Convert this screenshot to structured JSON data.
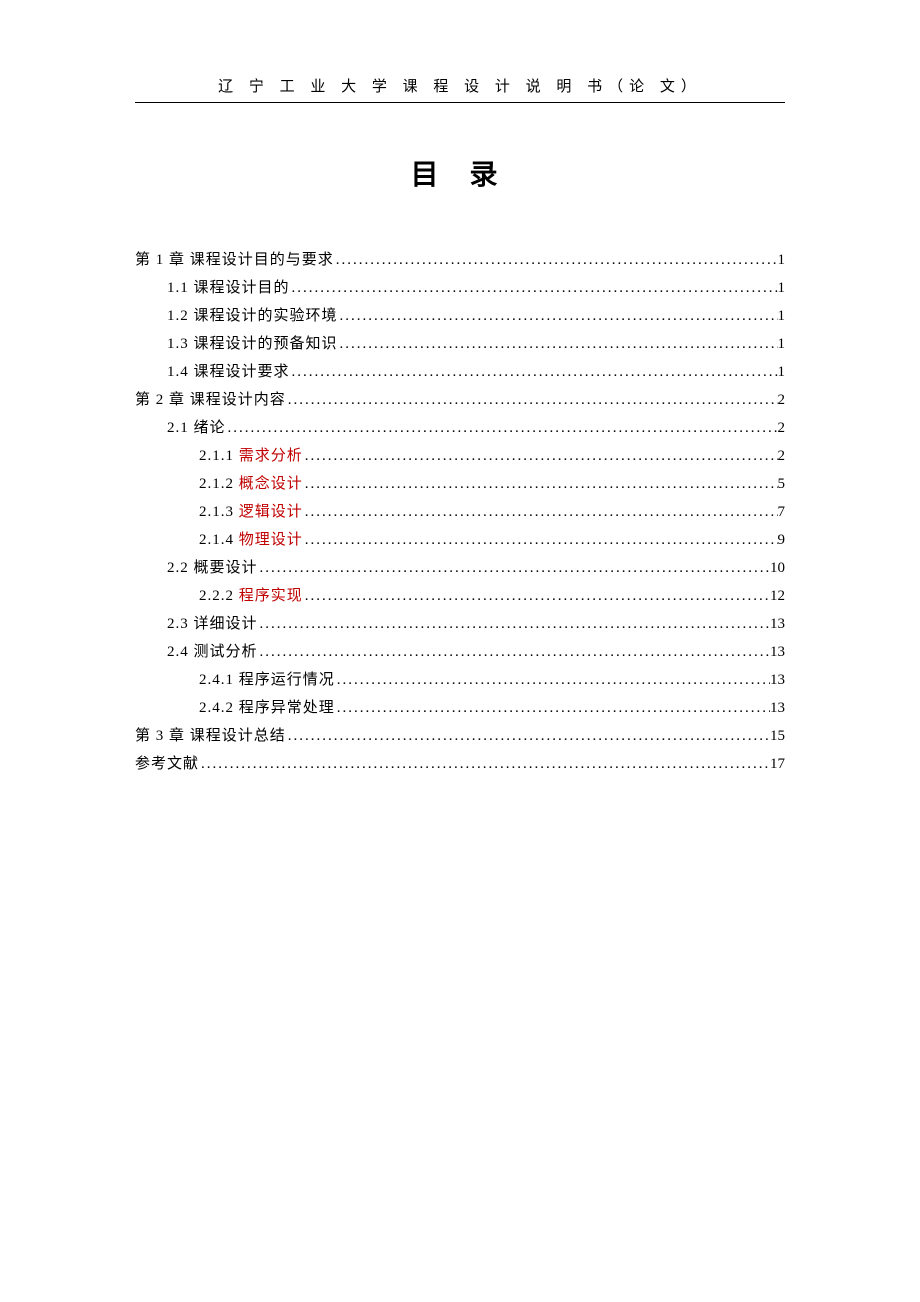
{
  "header": "辽 宁 工 业 大 学 课 程 设 计 说 明 书（论 文）",
  "title": "目  录",
  "toc": [
    {
      "level": 0,
      "label_pre": "第 1 章   课程设计目的与要求 ",
      "label_hl": "",
      "label_post": "",
      "page": "1"
    },
    {
      "level": 1,
      "label_pre": "1.1 课程设计目的",
      "label_hl": "",
      "label_post": "",
      "page": "1"
    },
    {
      "level": 1,
      "label_pre": "1.2 课程设计的实验环境",
      "label_hl": "",
      "label_post": "",
      "page": "1"
    },
    {
      "level": 1,
      "label_pre": "1.3 课程设计的预备知识",
      "label_hl": "",
      "label_post": "",
      "page": "1"
    },
    {
      "level": 1,
      "label_pre": "1.4 课程设计要求",
      "label_hl": "",
      "label_post": "",
      "page": "1"
    },
    {
      "level": 0,
      "label_pre": "第 2 章   课程设计内容 ",
      "label_hl": "",
      "label_post": "",
      "page": "2"
    },
    {
      "level": 1,
      "label_pre": "2.1 绪论",
      "label_hl": "",
      "label_post": "",
      "page": "2"
    },
    {
      "level": 2,
      "label_pre": "2.1.1 ",
      "label_hl": "需求分析",
      "label_post": "",
      "page": "2"
    },
    {
      "level": 2,
      "label_pre": "2.1.2 ",
      "label_hl": "概念设计",
      "label_post": "",
      "page": "5"
    },
    {
      "level": 2,
      "label_pre": "2.1.3 ",
      "label_hl": "逻辑设计",
      "label_post": "",
      "page": "7"
    },
    {
      "level": 2,
      "label_pre": "2.1.4 ",
      "label_hl": "物理设计",
      "label_post": "",
      "page": "9"
    },
    {
      "level": 1,
      "label_pre": "2.2 概要设计",
      "label_hl": "",
      "label_post": "",
      "page": "10"
    },
    {
      "level": 2,
      "label_pre": "2.2.2 ",
      "label_hl": "程序实现",
      "label_post": "",
      "page": "12"
    },
    {
      "level": 1,
      "label_pre": "2.3 详细设计",
      "label_hl": "",
      "label_post": "",
      "page": "13"
    },
    {
      "level": 1,
      "label_pre": "2.4 测试分析",
      "label_hl": "",
      "label_post": "",
      "page": "13"
    },
    {
      "level": 2,
      "label_pre": "2.4.1 程序运行情况",
      "label_hl": "",
      "label_post": "",
      "page": "13"
    },
    {
      "level": 2,
      "label_pre": "2.4.2 程序异常处理",
      "label_hl": "",
      "label_post": "",
      "page": "13"
    },
    {
      "level": 0,
      "label_pre": "第 3 章 课程设计总结 ",
      "label_hl": "",
      "label_post": "",
      "page": "15"
    },
    {
      "level": 0,
      "label_pre": "参考文献 ",
      "label_hl": "",
      "label_post": "",
      "page": "17"
    }
  ]
}
